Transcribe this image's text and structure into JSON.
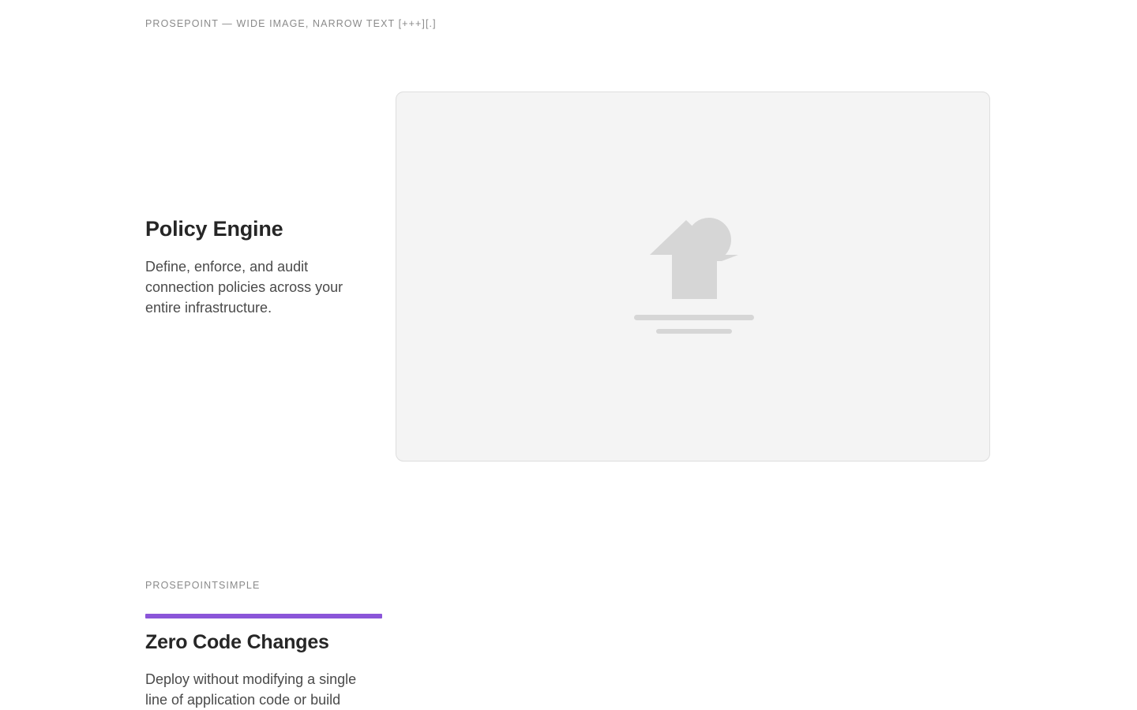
{
  "sections": [
    {
      "label": "PROSEPOINT — WIDE IMAGE, NARROW TEXT [+++][.]",
      "title": "Policy Engine",
      "description": "Define, enforce, and audit connection policies across your entire infrastructure.",
      "image_icon": "image-placeholder-icon"
    },
    {
      "label": "PROSEPOINTSIMPLE",
      "title": "Zero Code Changes",
      "description": "Deploy without modifying a single line of application code or build"
    }
  ],
  "colors": {
    "accent": "#8b55d9",
    "placeholder_bg": "#f4f4f4",
    "placeholder_glyph": "#d6d6d6"
  }
}
